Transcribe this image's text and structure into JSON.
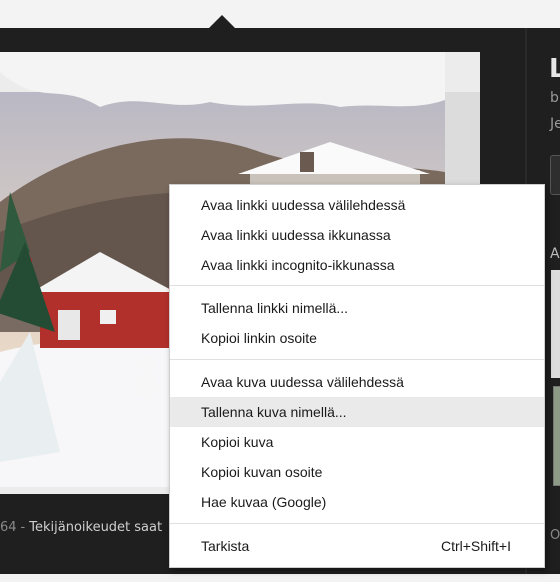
{
  "context_menu": {
    "items": [
      {
        "label": "Avaa linkki uudessa välilehdessä"
      },
      {
        "label": "Avaa linkki uudessa ikkunassa"
      },
      {
        "label": "Avaa linkki incognito-ikkunassa"
      },
      {
        "label": "Tallenna linkki nimellä..."
      },
      {
        "label": "Kopioi linkin osoite"
      },
      {
        "label": "Avaa kuva uudessa välilehdessä"
      },
      {
        "label": "Tallenna kuva nimellä...",
        "highlighted": true
      },
      {
        "label": "Kopioi kuva"
      },
      {
        "label": "Kopioi kuvan osoite"
      },
      {
        "label": "Hae kuvaa (Google)"
      },
      {
        "label": "Tarkista",
        "shortcut": "Ctrl+Shift+I"
      }
    ]
  },
  "caption": {
    "number": "64",
    "separator": "-",
    "text": "Tekijänoikeudet saat"
  },
  "side_panel": {
    "title_letter": "L",
    "line1": "b",
    "line2": "Je",
    "section_letter": "A",
    "footer_letter": "O"
  },
  "colors": {
    "panel_bg": "#1f1f1f",
    "menu_bg": "#ffffff",
    "menu_highlight": "#eaeaea"
  }
}
